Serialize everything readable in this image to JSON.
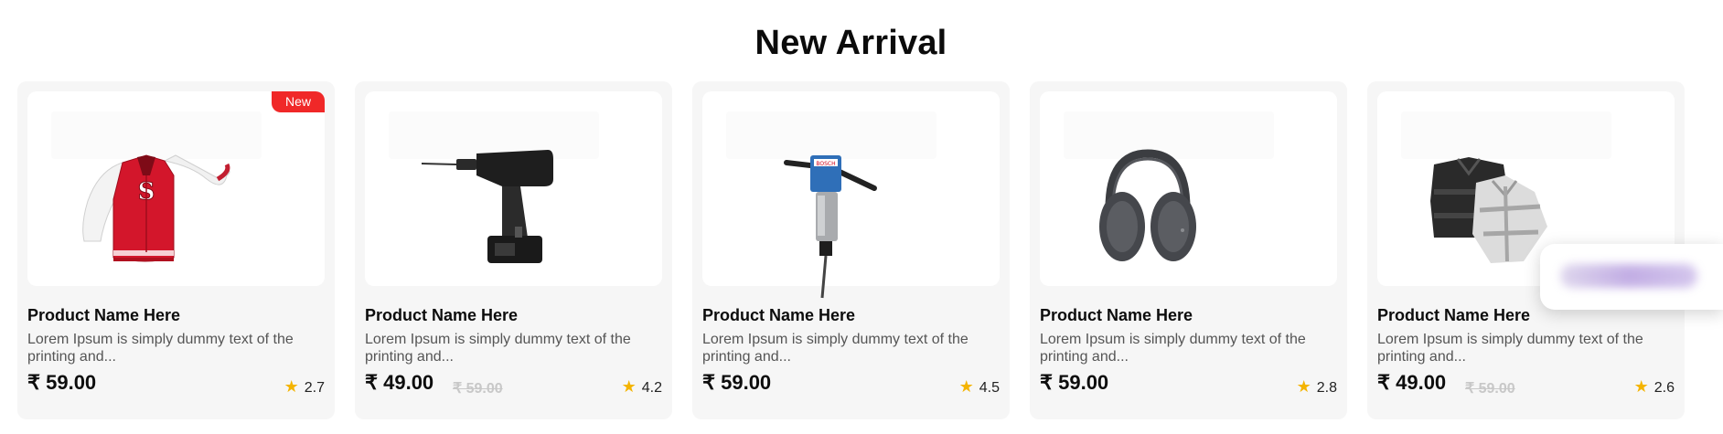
{
  "section": {
    "title": "New Arrival"
  },
  "products": [
    {
      "name": "Product Name Here",
      "desc": "Lorem Ipsum is simply dummy text of the printing and...",
      "price": "₹ 59.00",
      "old_price": "",
      "rating": "2.7",
      "badge": "New",
      "image": "red-varsity-jacket"
    },
    {
      "name": "Product Name Here",
      "desc": "Lorem Ipsum is simply dummy text of the printing and...",
      "price": "₹ 49.00",
      "old_price": "₹ 59.00",
      "rating": "4.2",
      "badge": "",
      "image": "cordless-drill"
    },
    {
      "name": "Product Name Here",
      "desc": "Lorem Ipsum is simply dummy text of the printing and...",
      "price": "₹ 59.00",
      "old_price": "",
      "rating": "4.5",
      "badge": "",
      "image": "demolition-hammer"
    },
    {
      "name": "Product Name Here",
      "desc": "Lorem Ipsum is simply dummy text of the printing and...",
      "price": "₹ 59.00",
      "old_price": "",
      "rating": "2.8",
      "badge": "",
      "image": "headphones"
    },
    {
      "name": "Product Name Here",
      "desc": "Lorem Ipsum is simply dummy text of the printing and...",
      "price": "₹ 49.00",
      "old_price": "₹ 59.00",
      "rating": "2.6",
      "badge": "",
      "image": "folded-shirts"
    }
  ],
  "colors": {
    "badge": "#f02828",
    "star": "#f4b400",
    "card_bg": "#f6f6f6"
  }
}
